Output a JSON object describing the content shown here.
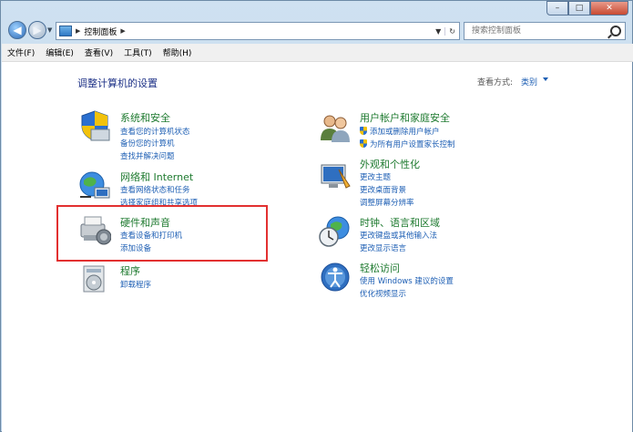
{
  "address": {
    "crumb": "控制面板",
    "refresh_icon": "refresh-icon"
  },
  "search": {
    "placeholder": "搜索控制面板"
  },
  "menu": [
    "文件(F)",
    "编辑(E)",
    "查看(V)",
    "工具(T)",
    "帮助(H)"
  ],
  "content": {
    "title": "调整计算机的设置",
    "view_by_label": "查看方式:",
    "view_by_value": "类别"
  },
  "categories": {
    "system": {
      "title": "系统和安全",
      "links": [
        "查看您的计算机状态",
        "备份您的计算机",
        "查找并解决问题"
      ]
    },
    "network": {
      "title": "网络和 Internet",
      "links": [
        "查看网络状态和任务",
        "选择家庭组和共享选项"
      ]
    },
    "hardware": {
      "title": "硬件和声音",
      "links": [
        "查看设备和打印机",
        "添加设备"
      ]
    },
    "programs": {
      "title": "程序",
      "links": [
        "卸载程序"
      ]
    },
    "users": {
      "title": "用户帐户和家庭安全",
      "links": [
        "添加或删除用户帐户",
        "为所有用户设置家长控制"
      ]
    },
    "appearance": {
      "title": "外观和个性化",
      "links": [
        "更改主题",
        "更改桌面背景",
        "调整屏幕分辨率"
      ]
    },
    "clock": {
      "title": "时钟、语言和区域",
      "links": [
        "更改键盘或其他输入法",
        "更改显示语言"
      ]
    },
    "access": {
      "title": "轻松访问",
      "links": [
        "使用 Windows 建议的设置",
        "优化视频显示"
      ]
    }
  },
  "colors": {
    "highlight": "#e23030",
    "link": "#1e5fb4",
    "category": "#1e7a2f"
  }
}
